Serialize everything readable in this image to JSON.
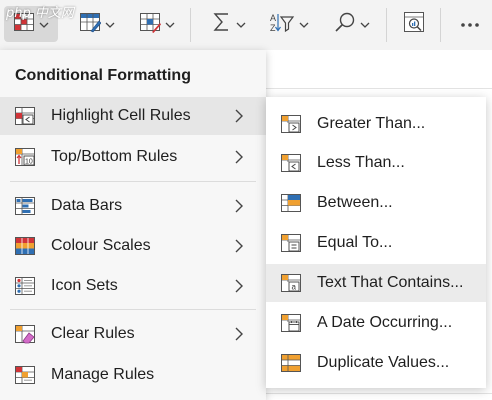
{
  "watermark": "php 中文网",
  "toolbar": {
    "buttons": [
      {
        "name": "conditional-formatting-button",
        "icon": "conditional-formatting-icon"
      },
      {
        "name": "format-as-table-button",
        "icon": "format-table-icon"
      },
      {
        "name": "cell-styles-button",
        "icon": "cell-styles-icon"
      },
      {
        "name": "autosum-button",
        "icon": "sigma-icon"
      },
      {
        "name": "sort-filter-button",
        "icon": "sort-filter-icon"
      },
      {
        "name": "find-select-button",
        "icon": "search-icon"
      },
      {
        "name": "analyze-data-button",
        "icon": "analyze-data-icon"
      },
      {
        "name": "more-options-button",
        "icon": "more-icon"
      }
    ]
  },
  "menu": {
    "title": "Conditional Formatting",
    "items": [
      {
        "label": "Highlight Cell Rules",
        "icon": "highlight-cell-rules-icon",
        "has_submenu": true
      },
      {
        "label": "Top/Bottom Rules",
        "icon": "top-bottom-rules-icon",
        "has_submenu": true
      },
      {
        "label": "Data Bars",
        "icon": "data-bars-icon",
        "has_submenu": true
      },
      {
        "label": "Colour Scales",
        "icon": "colour-scales-icon",
        "has_submenu": true
      },
      {
        "label": "Icon Sets",
        "icon": "icon-sets-icon",
        "has_submenu": true
      },
      {
        "label": "Clear Rules",
        "icon": "clear-rules-icon",
        "has_submenu": true
      },
      {
        "label": "Manage Rules",
        "icon": "manage-rules-icon",
        "has_submenu": false
      }
    ]
  },
  "submenu": {
    "items": [
      {
        "label": "Greater Than...",
        "icon": "greater-than-icon"
      },
      {
        "label": "Less Than...",
        "icon": "less-than-icon"
      },
      {
        "label": "Between...",
        "icon": "between-icon"
      },
      {
        "label": "Equal To...",
        "icon": "equal-to-icon"
      },
      {
        "label": "Text That Contains...",
        "icon": "text-contains-icon"
      },
      {
        "label": "A Date Occurring...",
        "icon": "date-occurring-icon"
      },
      {
        "label": "Duplicate Values...",
        "icon": "duplicate-values-icon"
      }
    ]
  },
  "colors": {
    "accent_blue": "#2f6fb3",
    "accent_red": "#d13438",
    "accent_orange": "#f0a030",
    "hover_gray": "#e6e6e6"
  }
}
